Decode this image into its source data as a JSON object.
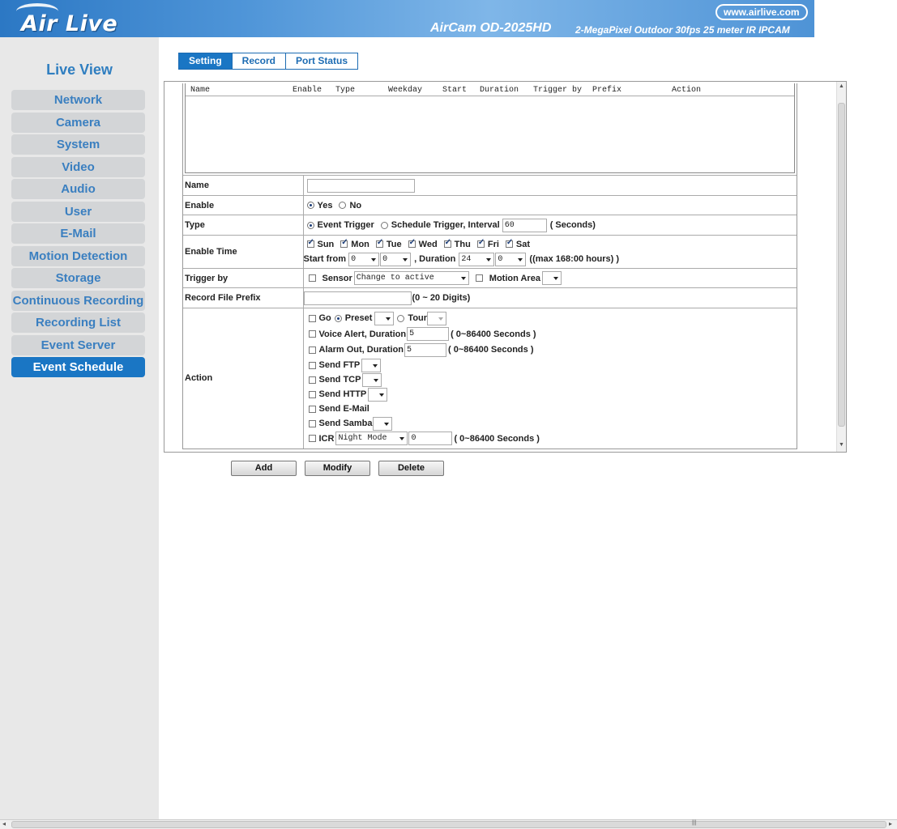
{
  "header": {
    "logo": "Air Live",
    "url": "www.airlive.com",
    "model": "AirCam OD-2025HD",
    "subtitle": "2-MegaPixel Outdoor 30fps 25 meter IR IPCAM"
  },
  "sidebar": {
    "live_view": "Live View",
    "items": [
      {
        "label": "Network"
      },
      {
        "label": "Camera"
      },
      {
        "label": "System"
      },
      {
        "label": "Video"
      },
      {
        "label": "Audio"
      },
      {
        "label": "User"
      },
      {
        "label": "E-Mail"
      },
      {
        "label": "Motion Detection"
      },
      {
        "label": "Storage"
      },
      {
        "label": "Continuous Recording"
      },
      {
        "label": "Recording List"
      },
      {
        "label": "Event Server"
      },
      {
        "label": "Event Schedule"
      }
    ],
    "active_item": "Event Schedule"
  },
  "tabs": [
    {
      "label": "Setting",
      "active": true
    },
    {
      "label": "Record",
      "active": false
    },
    {
      "label": "Port Status",
      "active": false
    }
  ],
  "list": {
    "columns": [
      "Name",
      "Enable",
      "Type",
      "Weekday",
      "Start",
      "Duration",
      "Trigger by",
      "Prefix",
      "Action"
    ],
    "rows": []
  },
  "form": {
    "name": {
      "label": "Name",
      "value": ""
    },
    "enable": {
      "label": "Enable",
      "yes": "Yes",
      "no": "No",
      "selected": "Yes"
    },
    "type": {
      "label": "Type",
      "event": "Event Trigger",
      "schedule": "Schedule Trigger, Interval",
      "interval": "60",
      "unit": "( Seconds)",
      "selected": "Event Trigger"
    },
    "enable_time": {
      "label": "Enable Time",
      "days": [
        {
          "label": "Sun",
          "checked": true
        },
        {
          "label": "Mon",
          "checked": true
        },
        {
          "label": "Tue",
          "checked": true
        },
        {
          "label": "Wed",
          "checked": true
        },
        {
          "label": "Thu",
          "checked": true
        },
        {
          "label": "Fri",
          "checked": true
        },
        {
          "label": "Sat",
          "checked": true
        }
      ],
      "start_label": "Start from",
      "start_hour": "0",
      "start_min": "0",
      "duration_label": ", Duration",
      "duration_hour": "24",
      "duration_min": "0",
      "max_note": "((max 168:00 hours) )"
    },
    "trigger_by": {
      "label": "Trigger by",
      "sensor": "Sensor",
      "sensor_value": "Change to active",
      "motion": "Motion Area",
      "motion_value": ""
    },
    "prefix": {
      "label": "Record File Prefix",
      "value": "",
      "note": "(0 ~ 20 Digits)"
    },
    "action": {
      "label": "Action",
      "go": "Go",
      "preset": "Preset",
      "tour": "Tour",
      "voice": "Voice Alert, Duration",
      "voice_value": "5",
      "voice_note": "( 0~86400 Seconds )",
      "alarm": "Alarm Out, Duration",
      "alarm_value": "5",
      "alarm_note": "( 0~86400 Seconds )",
      "ftp": "Send FTP",
      "tcp": "Send TCP",
      "http": "Send HTTP",
      "email": "Send E-Mail",
      "samba": "Send Samba",
      "icr": "ICR",
      "icr_mode": "Night Mode",
      "icr_value": "0",
      "icr_note": "( 0~86400 Seconds )"
    }
  },
  "buttons": {
    "add": "Add",
    "modify": "Modify",
    "delete": "Delete"
  }
}
